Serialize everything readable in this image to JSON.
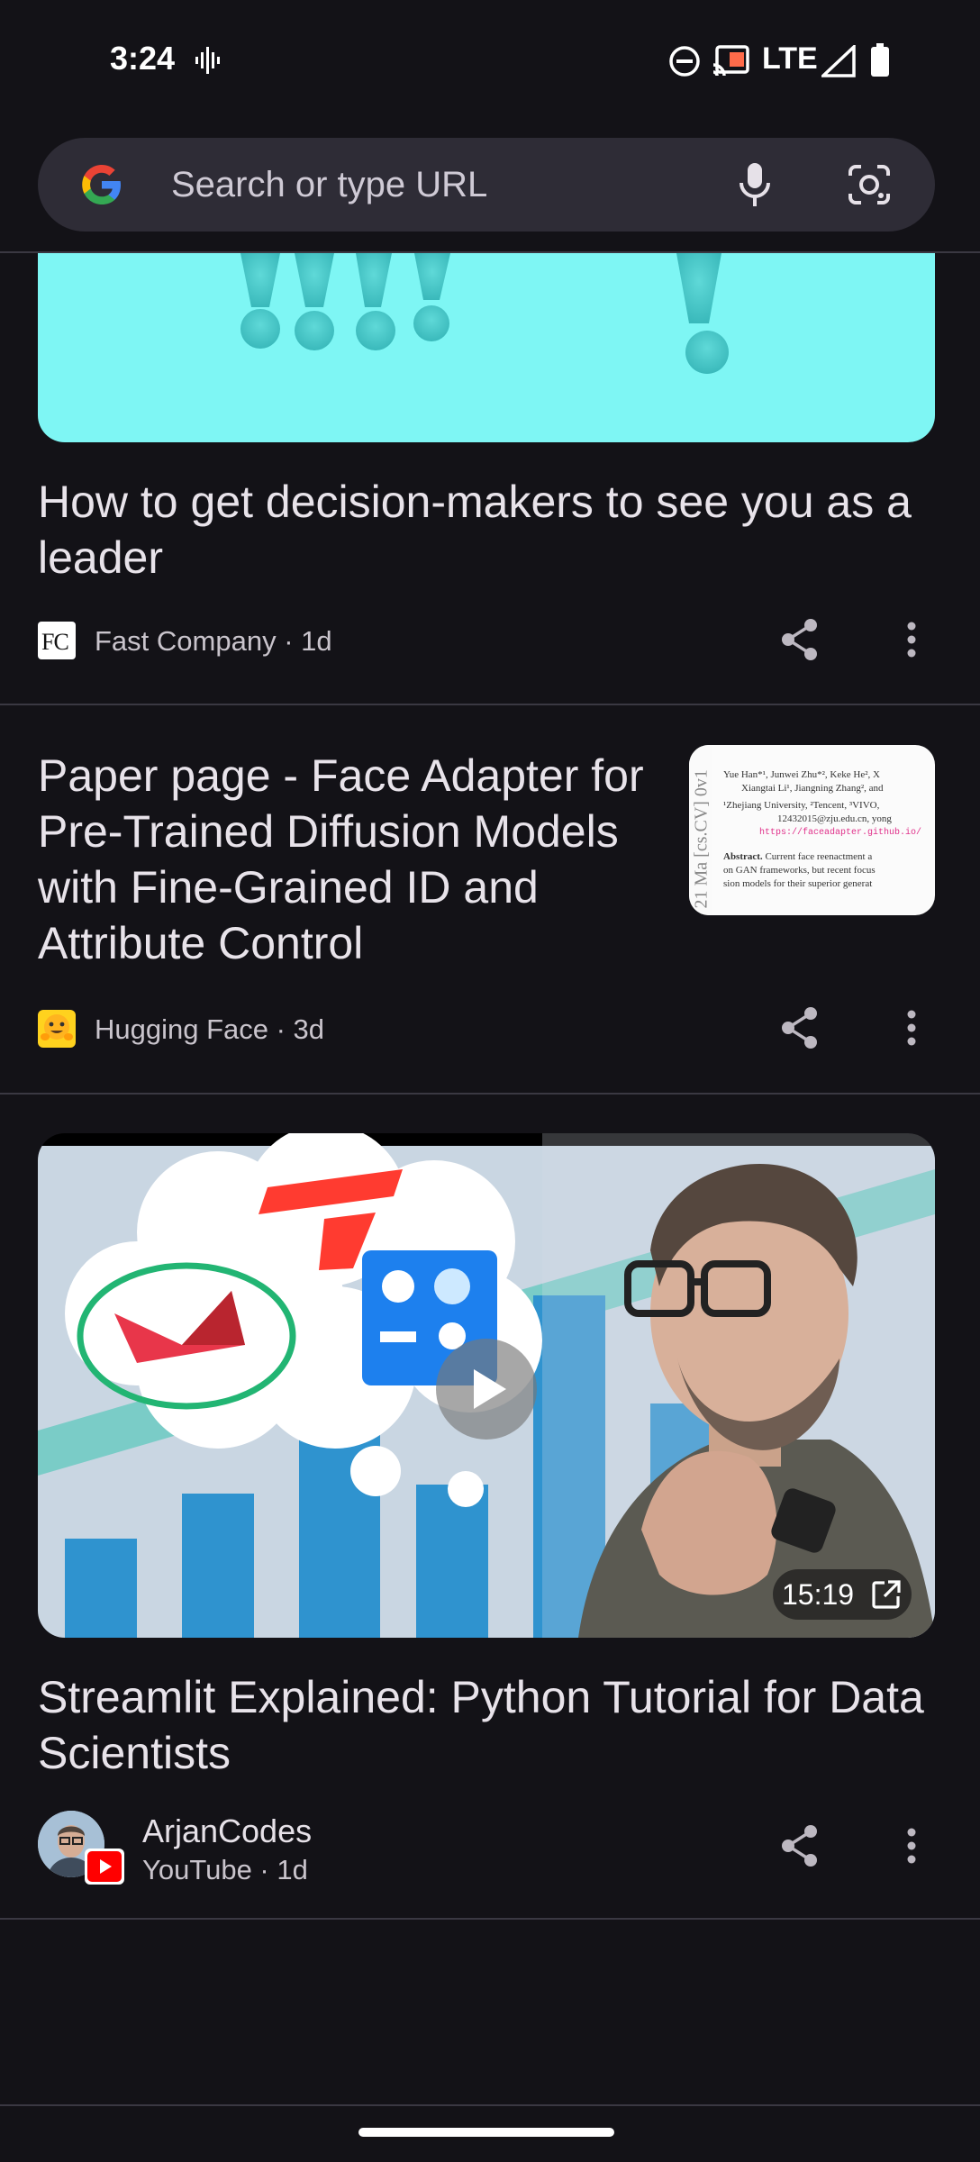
{
  "status_bar": {
    "time": "3:24",
    "network": "LTE",
    "icons": [
      "voice-activity-icon",
      "do-not-disturb-icon",
      "cast-icon",
      "signal-icon",
      "battery-icon"
    ]
  },
  "search": {
    "placeholder": "Search or type URL",
    "icons": [
      "google-logo-icon",
      "microphone-icon",
      "lens-camera-icon"
    ]
  },
  "feed": [
    {
      "title": "How to get decision-makers to see you as a leader",
      "source_logo_text": "FC",
      "source": "Fast Company · 1d"
    },
    {
      "title": "Paper page - Face Adapter for Pre-Trained Diffusion Models with Fine-Grained ID and Attribute Control",
      "source": "Hugging Face · 3d",
      "thumbnail_text": {
        "authors": "Yue Han*¹, Junwei Zhu*², Keke He², X",
        "authors2": "Xiangtai Li¹, Jiangning Zhang², and",
        "affil": "¹Zhejiang University, ²Tencent, ³VIVO,",
        "email": "12432015@zju.edu.cn, yong",
        "url": "https://faceadapter.github.io/",
        "abstract_label": "Abstract.",
        "abstract": "Current face reenactment a",
        "line2": "on GAN frameworks, but recent focus",
        "line3": "sion models for their superior generat",
        "side": "21 Ma  [cs.CV]  0v1"
      }
    },
    {
      "title": "Streamlit Explained: Python Tutorial for Data Scientists",
      "channel": "ArjanCodes",
      "source": "YouTube · 1d",
      "duration": "15:19"
    }
  ],
  "colors": {
    "background": "#131217",
    "search_bg": "#2e2c36",
    "divider": "#3a3842",
    "teal": "#7ef6f4"
  }
}
